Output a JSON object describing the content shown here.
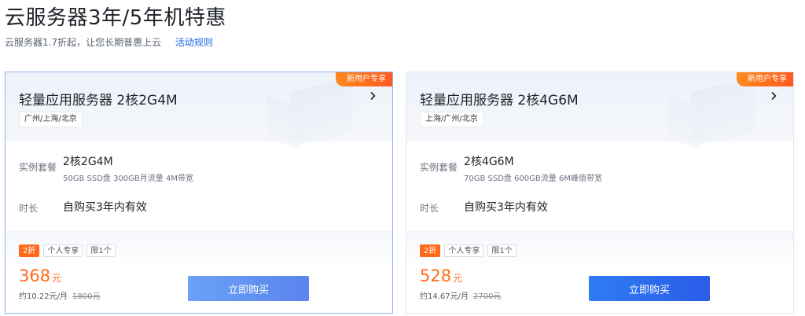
{
  "header": {
    "title": "云服务器3年/5年机特惠",
    "subtitle": "云服务器1.7折起，让您长期普惠上云",
    "rules_link": "活动规则"
  },
  "cards": [
    {
      "badge": "新用户专享",
      "name": "轻量应用服务器 2核2G4M",
      "icon": "chevron-right-icon",
      "region": "广州/上海/北京",
      "spec_label": "实例套餐",
      "spec_value": "2核2G4M",
      "spec_detail": "50GB SSD盘 300GB月流量 4M带宽",
      "duration_label": "时长",
      "duration_value": "自购买3年内有效",
      "tags": [
        "2折",
        "个人专享",
        "限1个"
      ],
      "price": "368",
      "price_unit": "元",
      "monthly": "约10.22元/月",
      "original_price": "1800元",
      "buy_label": "立即购买"
    },
    {
      "badge": "新用户专享",
      "name": "轻量应用服务器 2核4G6M",
      "icon": "chevron-right-icon",
      "region": "上海/广州/北京",
      "spec_label": "实例套餐",
      "spec_value": "2核4G6M",
      "spec_detail": "70GB SSD盘 600GB流量 6M峰值带宽",
      "duration_label": "时长",
      "duration_value": "自购买3年内有效",
      "tags": [
        "2折",
        "个人专享",
        "限1个"
      ],
      "price": "528",
      "price_unit": "元",
      "monthly": "约14.67元/月",
      "original_price": "2700元",
      "buy_label": "立即购买"
    }
  ],
  "colors": {
    "accent_orange": "#ff6a1a",
    "link_blue": "#1e66e6",
    "button_blue": "#2a5ce8"
  }
}
